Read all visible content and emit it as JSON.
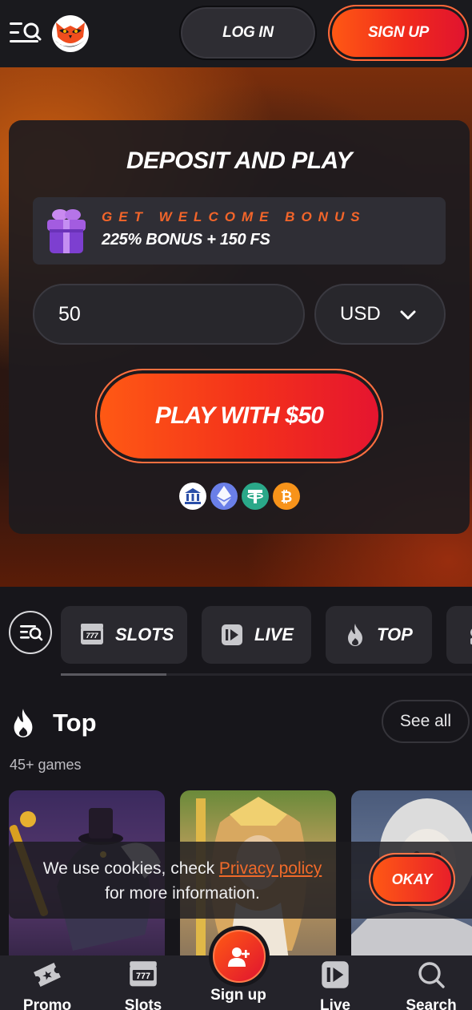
{
  "header": {
    "login_label": "LOG IN",
    "signup_label": "SIGN UP"
  },
  "deposit": {
    "title": "DEPOSIT AND PLAY",
    "bonus_kicker": "GET WELCOME BONUS",
    "bonus_text": "225% BONUS + 150 FS",
    "amount_value": "50",
    "currency": "USD",
    "play_label": "PLAY WITH $50",
    "payment_icons": [
      "bank-icon",
      "ethereum-icon",
      "tether-icon",
      "bitcoin-icon"
    ]
  },
  "categories": {
    "tabs": [
      {
        "label": "SLOTS",
        "icon": "slot-machine-icon"
      },
      {
        "label": "LIVE",
        "icon": "live-play-icon"
      },
      {
        "label": "TOP",
        "icon": "flame-icon"
      }
    ]
  },
  "section": {
    "title": "Top",
    "see_all": "See all",
    "count": "45+ games"
  },
  "cookie": {
    "text_before": "We use cookies, check ",
    "link": "Privacy policy",
    "text_after": "for more information.",
    "okay_label": "OKAY"
  },
  "bottom_nav": {
    "promo": "Promo",
    "slots": "Slots",
    "signup": "Sign up",
    "live": "Live",
    "search": "Search"
  },
  "colors": {
    "accent": "#ff5a14",
    "accent_red": "#e01330",
    "bonus_orange": "#f3652a",
    "background": "#17161b"
  }
}
